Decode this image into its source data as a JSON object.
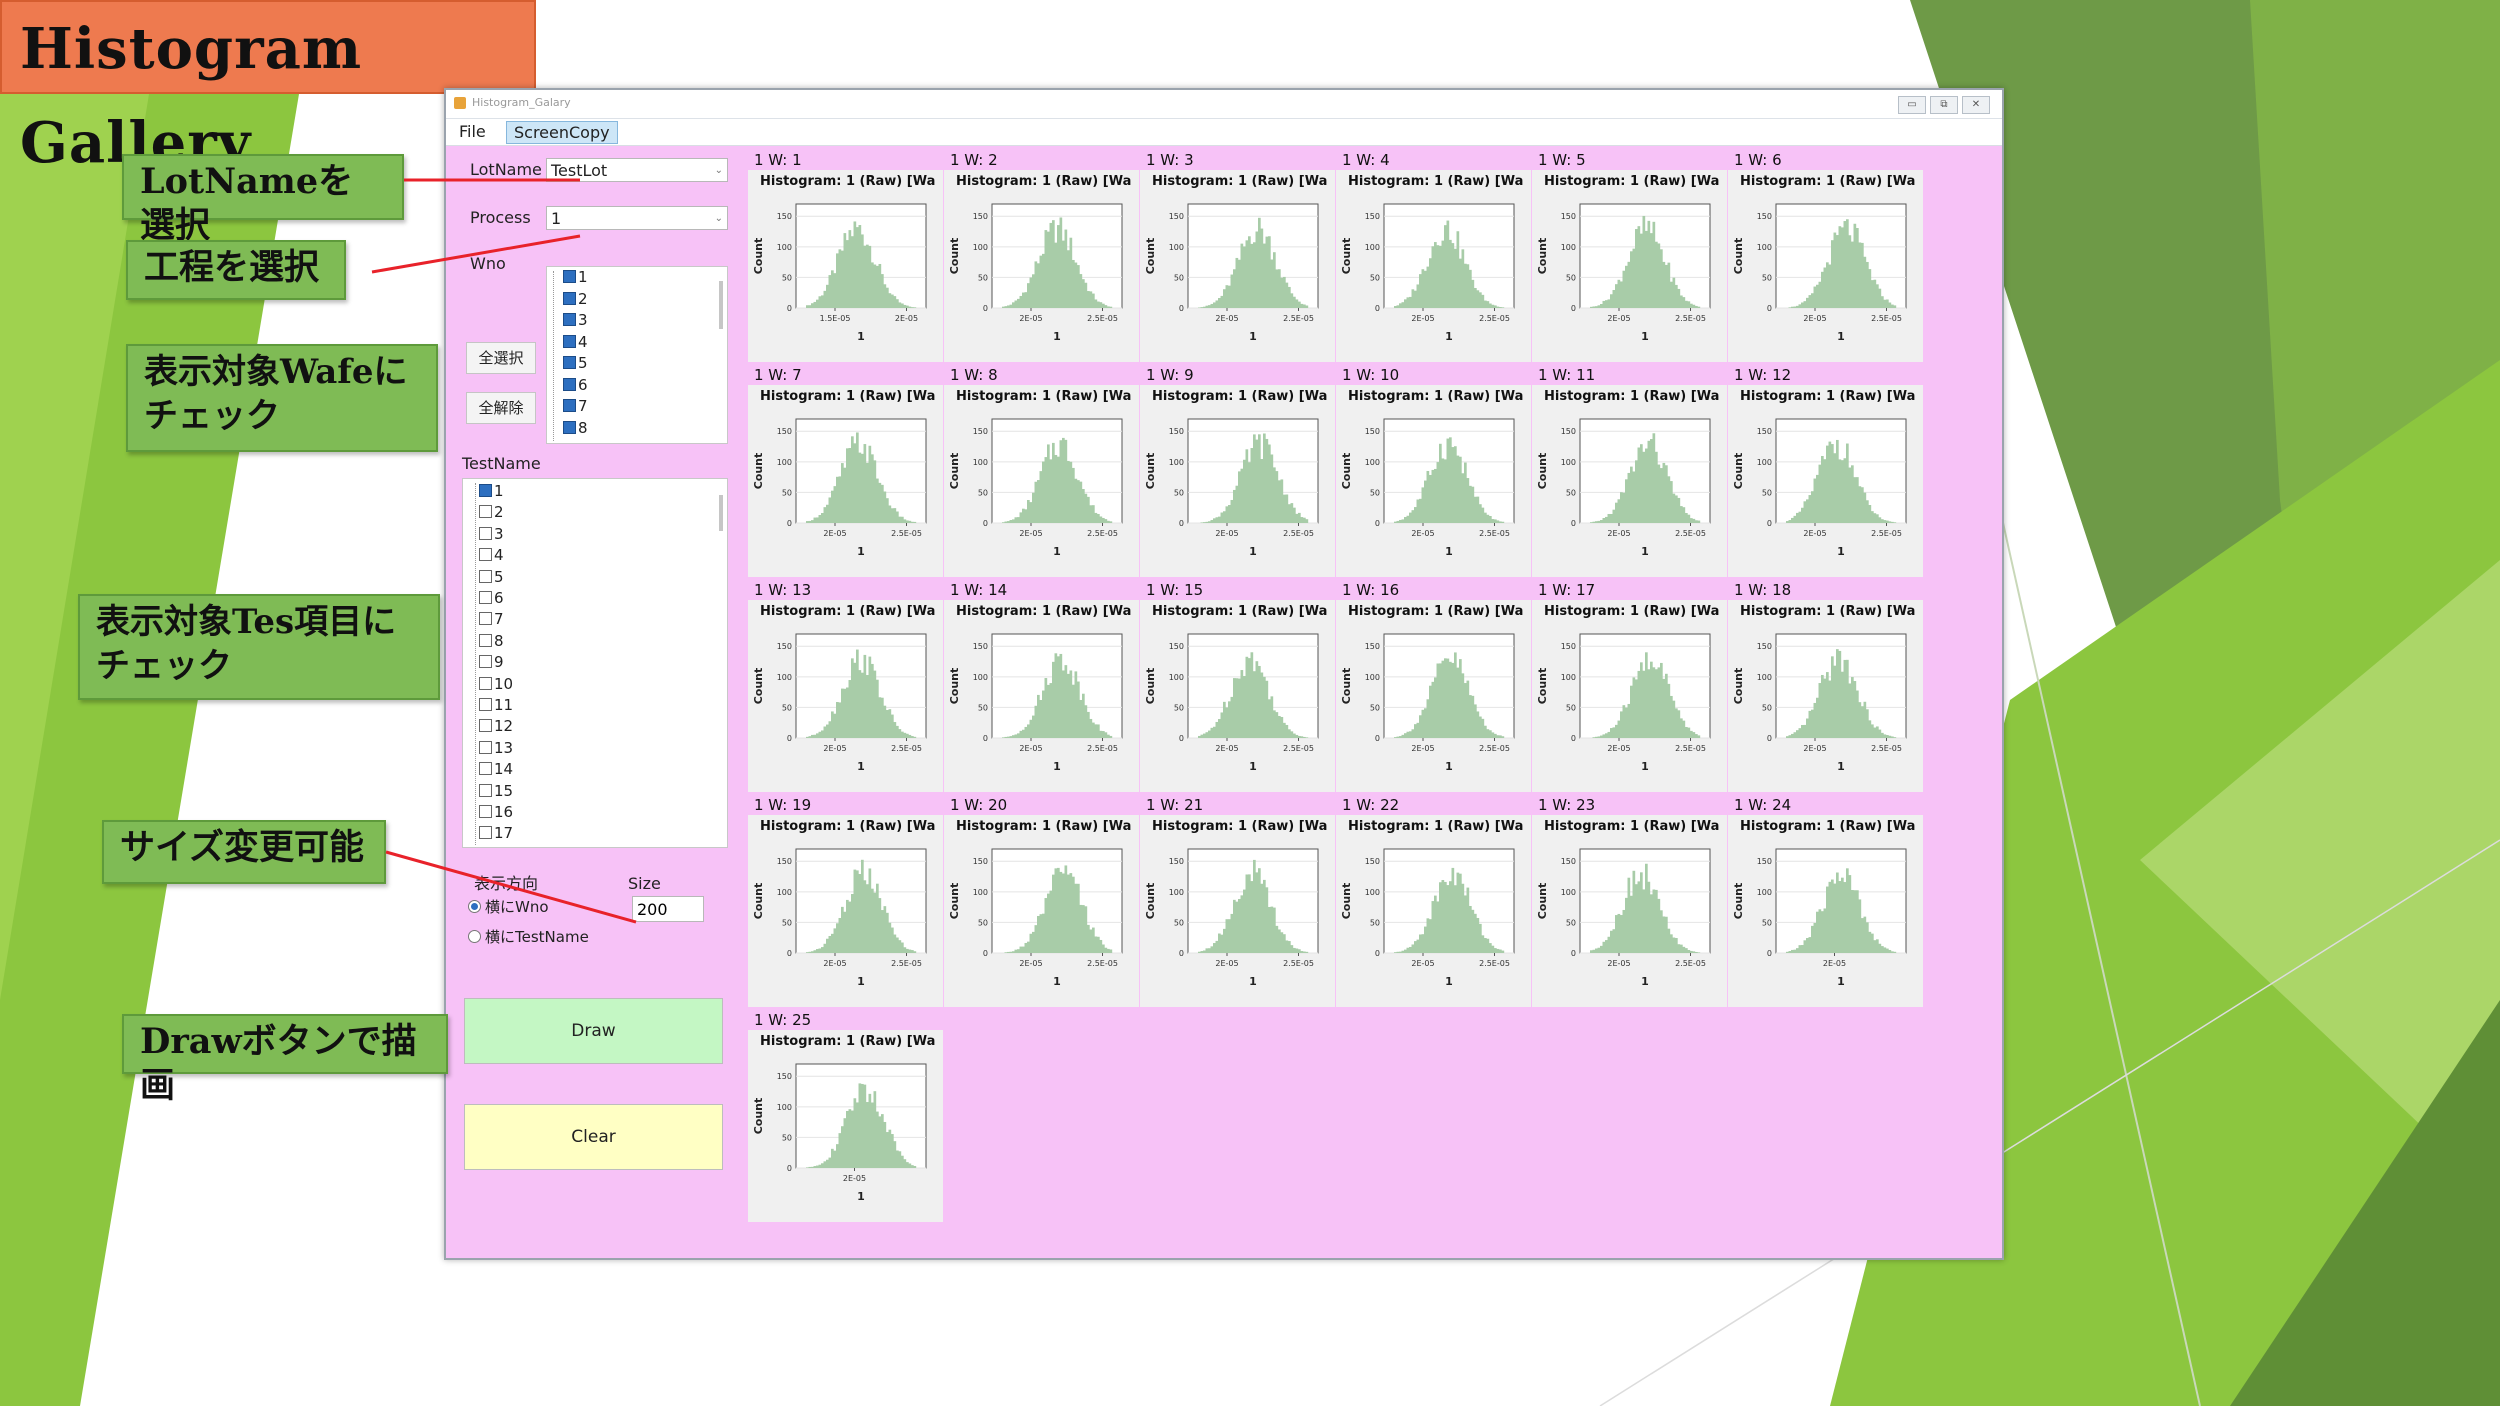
{
  "slide": {
    "title": "Histogram Gallery",
    "callouts": [
      "LotNameを選択",
      "工程を選択",
      "表示対象Wafeにチェック",
      "表示対象Tes項目にチェック",
      "サイズ変更可能",
      "Drawボタンで描画"
    ],
    "colors": {
      "title_bg": "#ee7a4f",
      "callout_bg": "#7fbb55",
      "arrow": "#e8222a",
      "bg_green": "#8cc63f"
    }
  },
  "window": {
    "title": "Histogram_Galary",
    "menus": [
      "File",
      "ScreenCopy"
    ],
    "controls": {
      "minimize": "▭",
      "maximize": "⧉",
      "close": "✕"
    },
    "background": "#f7c2f7"
  },
  "left_panel": {
    "lotname_label": "LotName",
    "lotname_value": "TestLot",
    "process_label": "Process",
    "process_value": "1",
    "wno_label": "Wno",
    "wno_items": [
      {
        "label": "1",
        "checked": true
      },
      {
        "label": "2",
        "checked": true
      },
      {
        "label": "3",
        "checked": true
      },
      {
        "label": "4",
        "checked": true
      },
      {
        "label": "5",
        "checked": true
      },
      {
        "label": "6",
        "checked": true
      },
      {
        "label": "7",
        "checked": true
      },
      {
        "label": "8",
        "checked": true
      }
    ],
    "select_all": "全選択",
    "deselect_all": "全解除",
    "testname_label": "TestName",
    "testname_items": [
      {
        "label": "1",
        "checked": true
      },
      {
        "label": "2",
        "checked": false
      },
      {
        "label": "3",
        "checked": false
      },
      {
        "label": "4",
        "checked": false
      },
      {
        "label": "5",
        "checked": false
      },
      {
        "label": "6",
        "checked": false
      },
      {
        "label": "7",
        "checked": false
      },
      {
        "label": "8",
        "checked": false
      },
      {
        "label": "9",
        "checked": false
      },
      {
        "label": "10",
        "checked": false
      },
      {
        "label": "11",
        "checked": false
      },
      {
        "label": "12",
        "checked": false
      },
      {
        "label": "13",
        "checked": false
      },
      {
        "label": "14",
        "checked": false
      },
      {
        "label": "15",
        "checked": false
      },
      {
        "label": "16",
        "checked": false
      },
      {
        "label": "17",
        "checked": false
      }
    ],
    "direction_label": "表示方向",
    "direction_options": [
      {
        "label": "横にWno",
        "selected": true
      },
      {
        "label": "横にTestName",
        "selected": false
      }
    ],
    "size_label": "Size",
    "size_value": "200",
    "draw_button": "Draw",
    "draw_color": "#c4f7c4",
    "clear_button": "Clear",
    "clear_color": "#ffffc4"
  },
  "gallery": {
    "histogram_title": "Histogram: 1 (Raw)  [Wa",
    "ylabel": "Count",
    "xlabel": "1",
    "yticks": [
      "0",
      "50",
      "100",
      "150"
    ],
    "bar_color": "#a8cca8",
    "cells": [
      {
        "label": "1  W: 1",
        "xticks": [
          "1.5E-05",
          "2E-05"
        ]
      },
      {
        "label": "1  W: 2",
        "xticks": [
          "2E-05",
          "2.5E-05"
        ]
      },
      {
        "label": "1  W: 3",
        "xticks": [
          "2E-05",
          "2.5E-05"
        ]
      },
      {
        "label": "1  W: 4",
        "xticks": [
          "2E-05",
          "2.5E-05"
        ]
      },
      {
        "label": "1  W: 5",
        "xticks": [
          "2E-05",
          "2.5E-05"
        ]
      },
      {
        "label": "1  W: 6",
        "xticks": [
          "2E-05",
          "2.5E-05"
        ]
      },
      {
        "label": "1  W: 7",
        "xticks": [
          "2E-05",
          "2.5E-05"
        ]
      },
      {
        "label": "1  W: 8",
        "xticks": [
          "2E-05",
          "2.5E-05"
        ]
      },
      {
        "label": "1  W: 9",
        "xticks": [
          "2E-05",
          "2.5E-05"
        ]
      },
      {
        "label": "1  W: 10",
        "xticks": [
          "2E-05",
          "2.5E-05"
        ]
      },
      {
        "label": "1  W: 11",
        "xticks": [
          "2E-05",
          "2.5E-05"
        ]
      },
      {
        "label": "1  W: 12",
        "xticks": [
          "2E-05",
          "2.5E-05"
        ]
      },
      {
        "label": "1  W: 13",
        "xticks": [
          "2E-05",
          "2.5E-05"
        ]
      },
      {
        "label": "1  W: 14",
        "xticks": [
          "2E-05",
          "2.5E-05"
        ]
      },
      {
        "label": "1  W: 15",
        "xticks": [
          "2E-05",
          "2.5E-05"
        ]
      },
      {
        "label": "1  W: 16",
        "xticks": [
          "2E-05",
          "2.5E-05"
        ]
      },
      {
        "label": "1  W: 17",
        "xticks": [
          "2E-05",
          "2.5E-05"
        ]
      },
      {
        "label": "1  W: 18",
        "xticks": [
          "2E-05",
          "2.5E-05"
        ]
      },
      {
        "label": "1  W: 19",
        "xticks": [
          "2E-05",
          "2.5E-05"
        ]
      },
      {
        "label": "1  W: 20",
        "xticks": [
          "2E-05",
          "2.5E-05"
        ]
      },
      {
        "label": "1  W: 21",
        "xticks": [
          "2E-05",
          "2.5E-05"
        ]
      },
      {
        "label": "1  W: 22",
        "xticks": [
          "2E-05",
          "2.5E-05"
        ]
      },
      {
        "label": "1  W: 23",
        "xticks": [
          "2E-05",
          "2.5E-05"
        ]
      },
      {
        "label": "1  W: 24",
        "xticks": [
          "2E-05"
        ]
      },
      {
        "label": "1  W: 25",
        "xticks": [
          "2E-05"
        ]
      }
    ]
  }
}
